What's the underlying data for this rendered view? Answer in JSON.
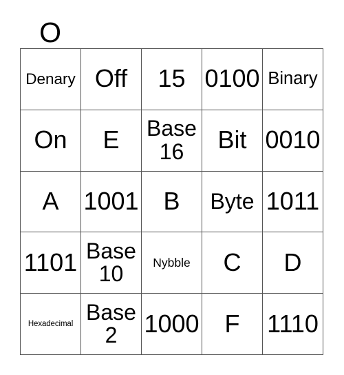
{
  "card": {
    "title_letters": [
      "O",
      "",
      "",
      "",
      ""
    ],
    "columns": 5,
    "rows": 5,
    "border_color": "#555555",
    "text_color": "#000000",
    "background_color": "#ffffff",
    "cells": [
      [
        {
          "text": "Denary",
          "size": "md"
        },
        {
          "text": "Off",
          "size": "xxl"
        },
        {
          "text": "15",
          "size": "xxl"
        },
        {
          "text": "0100",
          "size": "xxl"
        },
        {
          "text": "Binary",
          "size": "lg"
        }
      ],
      [
        {
          "text": "On",
          "size": "xxl"
        },
        {
          "text": "E",
          "size": "xxl"
        },
        {
          "text": "Base 16",
          "size": "wrap2"
        },
        {
          "text": "Bit",
          "size": "xxl"
        },
        {
          "text": "0010",
          "size": "xxl"
        }
      ],
      [
        {
          "text": "A",
          "size": "xxl"
        },
        {
          "text": "1001",
          "size": "xxl"
        },
        {
          "text": "B",
          "size": "xxl"
        },
        {
          "text": "Byte",
          "size": "xl"
        },
        {
          "text": "1011",
          "size": "xxl"
        }
      ],
      [
        {
          "text": "1101",
          "size": "xxl"
        },
        {
          "text": "Base 10",
          "size": "wrap2"
        },
        {
          "text": "Nybble",
          "size": "sm"
        },
        {
          "text": "C",
          "size": "xxl"
        },
        {
          "text": "D",
          "size": "xxl"
        }
      ],
      [
        {
          "text": "Hexadecimal",
          "size": "xs"
        },
        {
          "text": "Base 2",
          "size": "wrap2"
        },
        {
          "text": "1000",
          "size": "xxl"
        },
        {
          "text": "F",
          "size": "xxl"
        },
        {
          "text": "1110",
          "size": "xxl"
        }
      ]
    ]
  }
}
